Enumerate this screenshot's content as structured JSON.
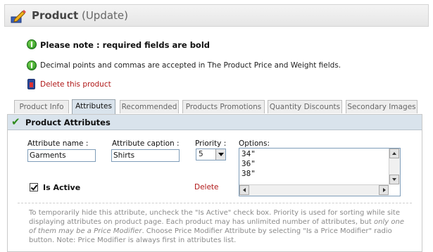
{
  "header": {
    "title": "Product",
    "mode": "(Update)",
    "icon": "pencil-edit-icon"
  },
  "notes": {
    "required": "Please note : required fields are bold",
    "decimal": "Decimal points and commas are accepted in The Product Price and Weight fields."
  },
  "delete_product_label": "Delete this product",
  "tabs": [
    {
      "label": "Product Info",
      "active": false
    },
    {
      "label": "Attributes",
      "active": true
    },
    {
      "label": "Recommended",
      "active": false
    },
    {
      "label": "Products Promotions",
      "active": false
    },
    {
      "label": "Quantity Discounts",
      "active": false
    },
    {
      "label": "Secondary Images",
      "active": false
    }
  ],
  "panel": {
    "title": "Product Attributes"
  },
  "attribute": {
    "name_label": "Attribute name :",
    "name_value": "Garments",
    "caption_label": "Attribute caption :",
    "caption_value": "Shirts",
    "priority_label": "Priority :",
    "priority_value": "5",
    "options_label": "Options:",
    "options": [
      "34\"",
      "36\"",
      "38\""
    ],
    "is_active_label": "Is Active",
    "is_active": true,
    "delete_label": "Delete"
  },
  "hint": {
    "part1": "To temporarily hide this attribute, uncheck the \"Is Active\" check box. Priority is used for sorting while site displaying attributes on product page. Each product may has unlimited number of attributes, but ",
    "part2_italic": "only one of them may be a Price Modifier",
    "part3": ". Choose Price Modifier Attribute by selecting \"Is a Price Modifier\" radio button. Note: Price Modifier is always first in attributes list."
  },
  "colors": {
    "tab_active_bg": "#d9e3ec",
    "delete_link": "#b01818",
    "hint_text": "#8a8a8a"
  }
}
